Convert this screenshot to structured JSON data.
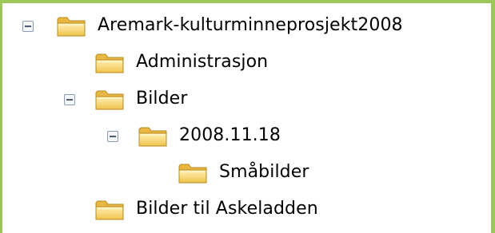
{
  "tree": {
    "root": {
      "label": "Aremark-kulturminneprosjekt2008",
      "expanded": true
    },
    "items": [
      {
        "label": "Administrasjon",
        "expanded": false
      },
      {
        "label": "Bilder",
        "expanded": true
      },
      {
        "label": "2008.11.18",
        "expanded": true
      },
      {
        "label": "Småbilder",
        "expanded": false
      },
      {
        "label": "Bilder til Askeladden",
        "expanded": false
      }
    ]
  },
  "colors": {
    "frame": "#9ec75a",
    "folder_fill": "#f7d774",
    "folder_edge": "#c9962a",
    "toggle_border": "#8a9db8"
  },
  "icons": {
    "folder": "folder-icon",
    "collapse": "minus-box-icon"
  }
}
